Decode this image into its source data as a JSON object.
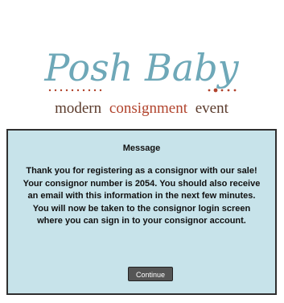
{
  "logo": {
    "brand_script": "Posh Baby",
    "tag_word1": "modern",
    "tag_word2": "consignment",
    "tag_word3": "event",
    "colors": {
      "teal": "#6ea8b8",
      "rust": "#b1432c",
      "brown": "#5b3b2c"
    }
  },
  "dialog": {
    "title": "Message",
    "body": "Thank you for registering as a consignor with our sale! Your consignor number is 2054. You should also receive an email with this information in the next few minutes. You will now be taken to the consignor login screen where you can sign in to your consignor account.",
    "continue_label": "Continue",
    "background": "#c7e3ea"
  }
}
